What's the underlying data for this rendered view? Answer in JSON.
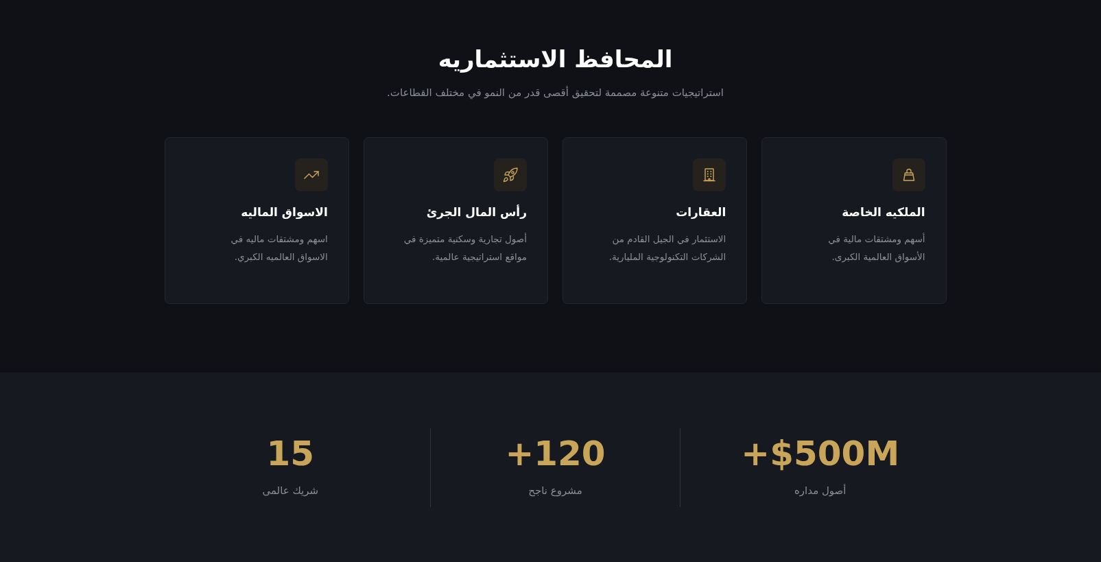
{
  "header": {
    "title": "المحافظ الاستثماريه",
    "subtitle": "استراتيجيات متنوعة مصممة لتحقيق أقصى قدر من النمو في مختلف القطاعات."
  },
  "cards": [
    {
      "kind": "bag",
      "title": "الملكيه الخاصة",
      "description": "أسهم ومشتقات مالية في الأسواق العالمية الكبرى."
    },
    {
      "kind": "building",
      "title": "العقارات",
      "description": "الاستثمار في الجيل القادم من الشركات التكنولوجية المليارية."
    },
    {
      "kind": "rocket",
      "title": "رأس المال الجرئ",
      "description": "أصول تجارية وسكنية متميزة في مواقع استراتيجية عالمية."
    },
    {
      "kind": "chart",
      "title": "الاسواق الماليه",
      "description": "اسهم ومشتقات ماليه في الاسواق العالميه الكبري."
    }
  ],
  "stats": [
    {
      "value": "+$500M",
      "label": "أصول مداره"
    },
    {
      "value": "+120",
      "label": "مشروع ناجح"
    },
    {
      "value": "15",
      "label": "شريك عالمى"
    }
  ]
}
